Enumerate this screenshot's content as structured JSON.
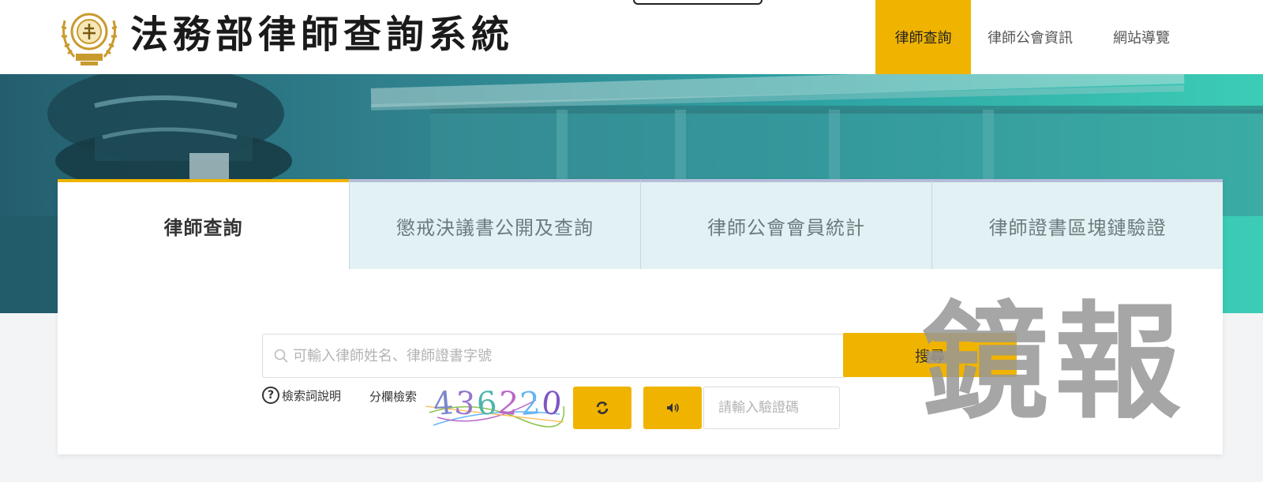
{
  "header": {
    "site_title": "法務部律師查詢系統",
    "nav": [
      "律師查詢",
      "律師公會資訊",
      "網站導覽"
    ],
    "active_nav_index": 0
  },
  "tabs": [
    "律師查詢",
    "懲戒決議書公開及查詢",
    "律師公會會員統計",
    "律師證書區塊鏈驗證"
  ],
  "active_tab_index": 0,
  "search": {
    "placeholder": "可輸入律師姓名、律師證書字號",
    "value": "",
    "button_label": "搜尋",
    "help_label": "檢索詞說明",
    "field_search_label": "分欄檢索"
  },
  "captcha": {
    "code": "436220",
    "input_placeholder": "請輸入驗證碼"
  },
  "icons": {
    "search": "search-icon",
    "help": "question-circle-icon",
    "refresh": "refresh-icon",
    "audio": "speaker-icon"
  },
  "colors": {
    "accent": "#f0b400",
    "hero_start": "#245e6e",
    "hero_end": "#3ccdb6"
  },
  "watermark": "鏡報"
}
